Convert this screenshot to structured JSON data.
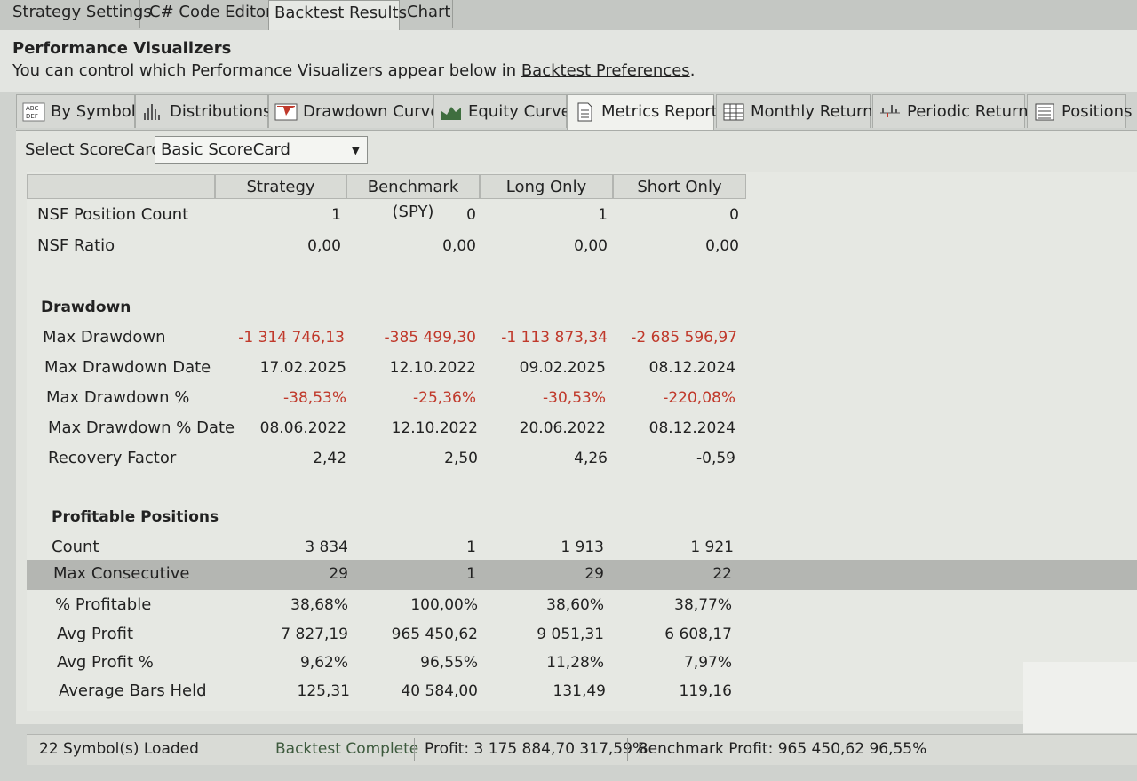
{
  "top_tabs": [
    "Strategy Settings",
    "C# Code Editor",
    "Backtest Results",
    "Chart"
  ],
  "header": {
    "title": "Performance Visualizers",
    "desc_prefix": "You can control which Performance Visualizers appear below in ",
    "desc_link": "Backtest Preferences",
    "desc_suffix": "."
  },
  "vis_tabs": [
    {
      "label": "By Symbol",
      "icon": "abc-def-icon"
    },
    {
      "label": "Distributions",
      "icon": "histogram-icon"
    },
    {
      "label": "Drawdown Curve",
      "icon": "drawdown-icon"
    },
    {
      "label": "Equity Curve",
      "icon": "area-chart-icon"
    },
    {
      "label": "Metrics Report",
      "icon": "document-icon"
    },
    {
      "label": "Monthly Returns",
      "icon": "table-icon"
    },
    {
      "label": "Periodic Returns",
      "icon": "bar-chart-icon"
    },
    {
      "label": "Positions",
      "icon": "list-icon"
    }
  ],
  "scorecard": {
    "label": "Select ScoreCard:",
    "value": "Basic ScoreCard"
  },
  "columns": [
    "Strategy",
    "Benchmark (SPY)",
    "Long Only",
    "Short Only"
  ],
  "rows": {
    "nsf_count": {
      "label": "NSF Position Count",
      "values": [
        "1",
        "0",
        "1",
        "0"
      ]
    },
    "nsf_ratio": {
      "label": "NSF Ratio",
      "values": [
        "0,00",
        "0,00",
        "0,00",
        "0,00"
      ]
    },
    "drawdown_title": "Drawdown",
    "max_dd": {
      "label": "Max Drawdown",
      "values": [
        "-1 314 746,13",
        "-385 499,30",
        "-1 113 873,34",
        "-2 685 596,97"
      ]
    },
    "max_dd_date": {
      "label": "Max Drawdown Date",
      "values": [
        "17.02.2025",
        "12.10.2022",
        "09.02.2025",
        "08.12.2024"
      ]
    },
    "max_dd_pct": {
      "label": "Max Drawdown %",
      "values": [
        "-38,53%",
        "-25,36%",
        "-30,53%",
        "-220,08%"
      ]
    },
    "max_dd_pct_date": {
      "label": "Max Drawdown % Date",
      "values": [
        "08.06.2022",
        "12.10.2022",
        "20.06.2022",
        "08.12.2024"
      ]
    },
    "recovery": {
      "label": "Recovery Factor",
      "values": [
        "2,42",
        "2,50",
        "4,26",
        "-0,59"
      ]
    },
    "profitable_title": "Profitable Positions",
    "count": {
      "label": "Count",
      "values": [
        "3 834",
        "1",
        "1 913",
        "1 921"
      ]
    },
    "max_consec": {
      "label": "Max Consecutive",
      "values": [
        "29",
        "1",
        "29",
        "22"
      ]
    },
    "pct_profitable": {
      "label": "% Profitable",
      "values": [
        "38,68%",
        "100,00%",
        "38,60%",
        "38,77%"
      ]
    },
    "avg_profit": {
      "label": "Avg Profit",
      "values": [
        "7 827,19",
        "965 450,62",
        "9 051,31",
        "6 608,17"
      ]
    },
    "avg_profit_pct": {
      "label": "Avg Profit %",
      "values": [
        "9,62%",
        "96,55%",
        "11,28%",
        "7,97%"
      ]
    },
    "avg_bars": {
      "label": "Average Bars Held",
      "values": [
        "125,31",
        "40 584,00",
        "131,49",
        "119,16"
      ]
    }
  },
  "status": {
    "symbols": "22 Symbol(s) Loaded",
    "state": "Backtest Complete",
    "profit": "Profit: 3 175 884,70 317,59%",
    "benchmark": "Benchmark Profit: 965 450,62 96,55%"
  }
}
